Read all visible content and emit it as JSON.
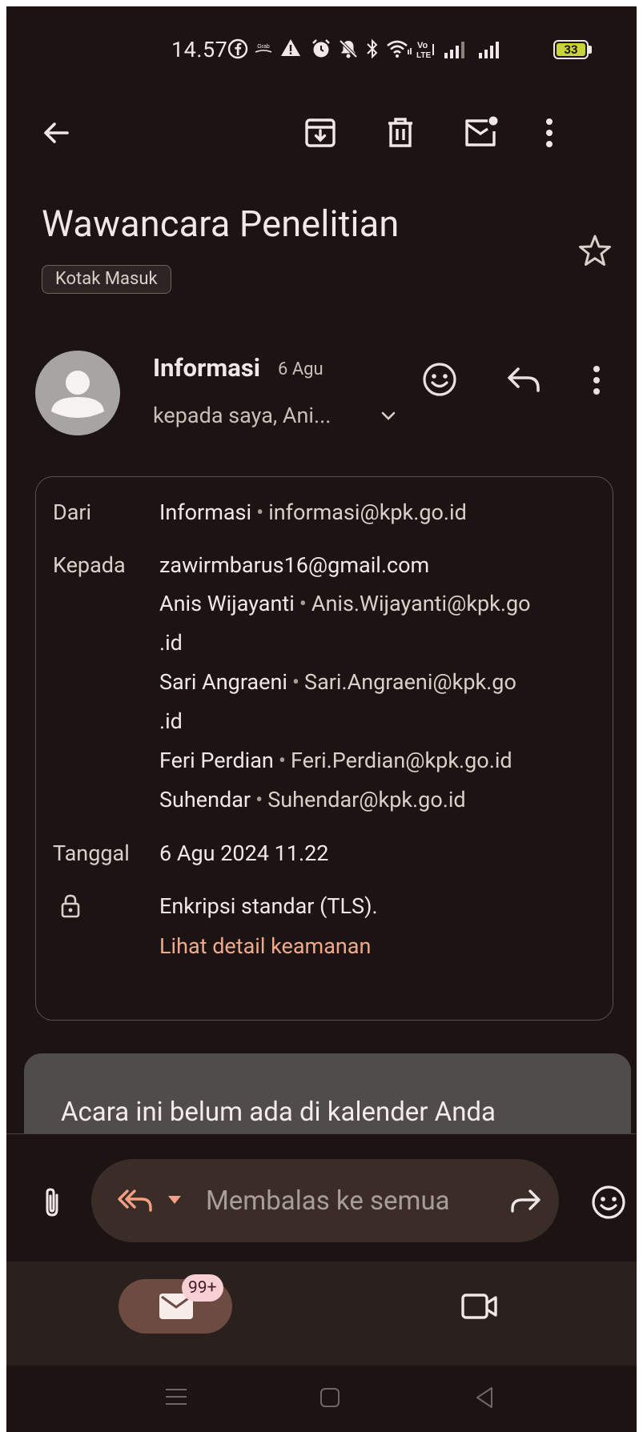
{
  "status_bar": {
    "time": "14.57",
    "battery": "33",
    "icons": [
      "facebook-icon",
      "grab-icon",
      "warning-icon",
      "alarm-icon",
      "mute-icon",
      "bluetooth-icon",
      "wifi-icon",
      "volte-icon",
      "signal-icon",
      "signal-icon"
    ]
  },
  "toolbar": {
    "back": "arrow-back-icon",
    "actions": [
      "archive-icon",
      "delete-icon",
      "mark-unread-icon",
      "more-vert-icon"
    ]
  },
  "email": {
    "subject": "Wawancara Penelitian",
    "label": "Kotak Masuk",
    "sender": "Informasi",
    "date_short": "6 Agu",
    "recipients_summary": "kepada saya, Ani..."
  },
  "details": {
    "from_label": "Dari",
    "from_name": "Informasi",
    "from_email": "informasi@kpk.go.id",
    "to_label": "Kepada",
    "to_first": "zawirmbarus16@gmail.com",
    "recipients": [
      {
        "name": "Anis Wijayanti",
        "email": "Anis.Wijayanti@kpk.go",
        "email_cont": ".id"
      },
      {
        "name": "Sari Angraeni",
        "email": "Sari.Angraeni@kpk.go",
        "email_cont": ".id"
      },
      {
        "name": "Feri Perdian",
        "email": "Feri.Perdian@kpk.go.id"
      },
      {
        "name": "Suhendar",
        "email": "Suhendar@kpk.go.id"
      }
    ],
    "date_label": "Tanggal",
    "date_value": "6 Agu 2024 11.22",
    "encryption": "Enkripsi standar (TLS).",
    "security_link": "Lihat detail keamanan"
  },
  "calendar": {
    "text": "Acara ini belum ada di kalender Anda"
  },
  "reply": {
    "placeholder": "Membalas ke semua"
  },
  "bottom_nav": {
    "mail_badge": "99+"
  },
  "colors": {
    "background": "#1b1412",
    "link": "#f0a98a",
    "reply_accent": "#f3a182",
    "badge": "#f7d0d4"
  }
}
